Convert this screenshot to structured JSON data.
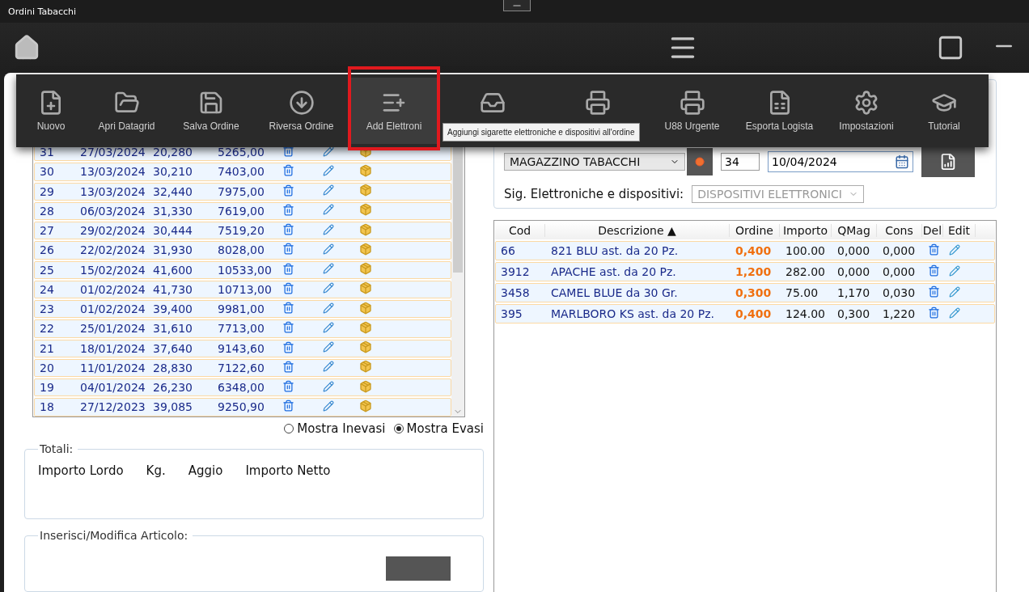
{
  "window": {
    "title": "Ordini Tabacchi"
  },
  "menu": {
    "items": [
      {
        "label": "Nuovo",
        "selected": false
      },
      {
        "label": "Apri Datagrid",
        "selected": false
      },
      {
        "label": "Salva Ordine",
        "selected": false
      },
      {
        "label": "Riversa Ordine",
        "selected": false
      },
      {
        "label": "Add Elettroni",
        "selected": true,
        "annotated": true
      },
      {
        "selected": false
      },
      {
        "selected": false
      },
      {
        "label": "U88 Urgente",
        "selected": false
      },
      {
        "label": "Esporta Logista",
        "selected": false
      },
      {
        "label": "Impostazioni",
        "selected": false
      },
      {
        "label": "Tutorial",
        "selected": false
      }
    ],
    "tooltip": "Aggiungi sigarette elettroniche e dispositivi all'ordine"
  },
  "orders": {
    "rows": [
      [
        "31",
        "27/03/2024",
        "20,280",
        "5265,00"
      ],
      [
        "30",
        "13/03/2024",
        "30,210",
        "7403,00"
      ],
      [
        "29",
        "13/03/2024",
        "32,440",
        "7975,00"
      ],
      [
        "28",
        "06/03/2024",
        "31,330",
        "7619,00"
      ],
      [
        "27",
        "29/02/2024",
        "30,444",
        "7519,20"
      ],
      [
        "26",
        "22/02/2024",
        "31,930",
        "8028,00"
      ],
      [
        "25",
        "15/02/2024",
        "41,600",
        "10533,00"
      ],
      [
        "24",
        "01/02/2024",
        "41,730",
        "10713,00"
      ],
      [
        "23",
        "01/02/2024",
        "39,400",
        "9981,00"
      ],
      [
        "22",
        "25/01/2024",
        "31,610",
        "7713,00"
      ],
      [
        "21",
        "18/01/2024",
        "37,640",
        "9143,60"
      ],
      [
        "20",
        "11/01/2024",
        "28,830",
        "7122,60"
      ],
      [
        "19",
        "04/01/2024",
        "26,230",
        "6348,00"
      ],
      [
        "18",
        "27/12/2023",
        "39,085",
        "9250,90"
      ]
    ]
  },
  "filter": [
    {
      "label": "Mostra Inevasi",
      "selected": false
    },
    {
      "label": "Mostra Evasi",
      "selected": true
    }
  ],
  "totals": {
    "title": "Totali:",
    "labels": [
      "Importo Lordo",
      "Kg.",
      "Aggio",
      "Importo Netto"
    ]
  },
  "insert": {
    "title": "Inserisci/Modifica Articolo:"
  },
  "order_form": {
    "supplier": "MAGAZZINO TABACCHI",
    "number": "34",
    "date": "10/04/2024",
    "category_label": "Sig. Elettroniche e dispositivi:",
    "category": "DISPOSITIVI ELETTRONICI",
    "category_disabled": true
  },
  "articles": {
    "columns": [
      "Cod",
      "Descrizione ▲",
      "Ordine",
      "Importo",
      "QMag",
      "Cons",
      "Del",
      "Edit"
    ],
    "rows": [
      [
        "66",
        "821 BLU ast. da 20 Pz.",
        "0,400",
        "100.00",
        "0,000",
        "0,000"
      ],
      [
        "3912",
        "APACHE ast. da 20 Pz.",
        "1,200",
        "282.00",
        "0,000",
        "0,000"
      ],
      [
        "3458",
        "CAMEL BLUE da 30 Gr.",
        "0,300",
        "75.00",
        "1,170",
        "0,030"
      ],
      [
        "395",
        "MARLBORO KS ast. da 20 Pz.",
        "0,400",
        "124.00",
        "0,300",
        "1,220"
      ]
    ]
  }
}
